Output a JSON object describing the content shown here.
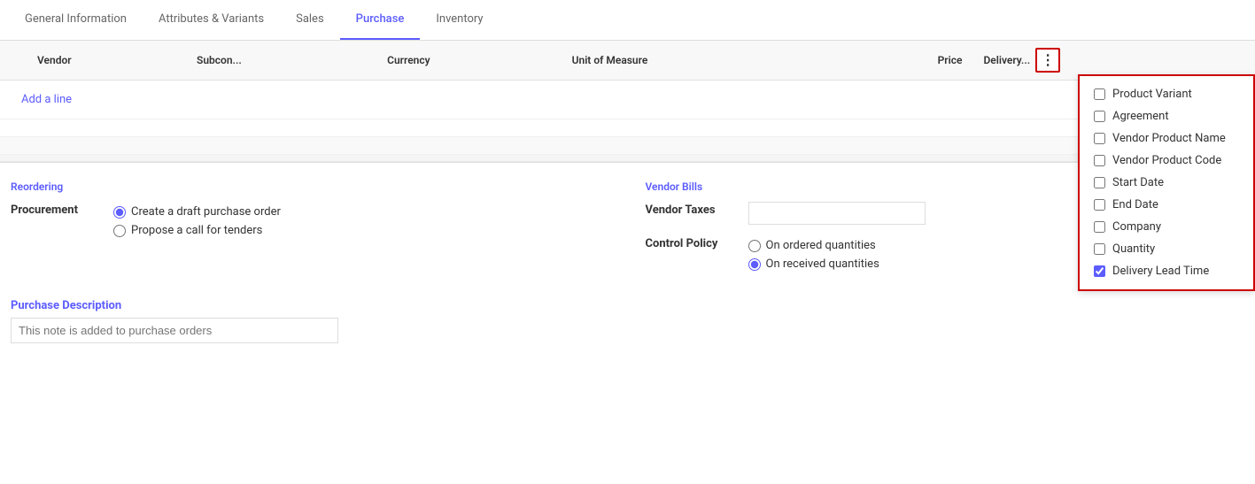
{
  "tabs": [
    {
      "id": "general",
      "label": "General Information",
      "active": false
    },
    {
      "id": "attributes",
      "label": "Attributes & Variants",
      "active": false
    },
    {
      "id": "sales",
      "label": "Sales",
      "active": false
    },
    {
      "id": "purchase",
      "label": "Purchase",
      "active": true
    },
    {
      "id": "inventory",
      "label": "Inventory",
      "active": false
    }
  ],
  "table": {
    "columns": [
      {
        "id": "vendor",
        "label": "Vendor"
      },
      {
        "id": "subcon",
        "label": "Subcon..."
      },
      {
        "id": "currency",
        "label": "Currency"
      },
      {
        "id": "uom",
        "label": "Unit of Measure"
      },
      {
        "id": "price",
        "label": "Price"
      },
      {
        "id": "delivery",
        "label": "Delivery..."
      }
    ],
    "add_line_label": "Add a line",
    "rows": []
  },
  "dropdown": {
    "items": [
      {
        "id": "product_variant",
        "label": "Product Variant",
        "checked": false
      },
      {
        "id": "agreement",
        "label": "Agreement",
        "checked": false
      },
      {
        "id": "vendor_product_name",
        "label": "Vendor Product Name",
        "checked": false
      },
      {
        "id": "vendor_product_code",
        "label": "Vendor Product Code",
        "checked": false
      },
      {
        "id": "start_date",
        "label": "Start Date",
        "checked": false
      },
      {
        "id": "end_date",
        "label": "End Date",
        "checked": false
      },
      {
        "id": "company",
        "label": "Company",
        "checked": false
      },
      {
        "id": "quantity",
        "label": "Quantity",
        "checked": false
      },
      {
        "id": "delivery_lead_time",
        "label": "Delivery Lead Time",
        "checked": true
      }
    ]
  },
  "reordering": {
    "section_title": "Reordering",
    "procurement_label": "Procurement",
    "radio_options": [
      {
        "id": "draft",
        "label": "Create a draft purchase order",
        "selected": true
      },
      {
        "id": "tenders",
        "label": "Propose a call for tenders",
        "selected": false
      }
    ]
  },
  "vendor_bills": {
    "section_title": "Vendor Bills",
    "vendor_taxes_label": "Vendor Taxes",
    "vendor_taxes_value": "",
    "control_policy_label": "Control Policy",
    "control_policy_options": [
      {
        "id": "ordered",
        "label": "On ordered quantities",
        "selected": false
      },
      {
        "id": "received",
        "label": "On received quantities",
        "selected": true
      }
    ]
  },
  "purchase_description": {
    "label": "Purchase Description",
    "placeholder": "This note is added to purchase orders"
  }
}
